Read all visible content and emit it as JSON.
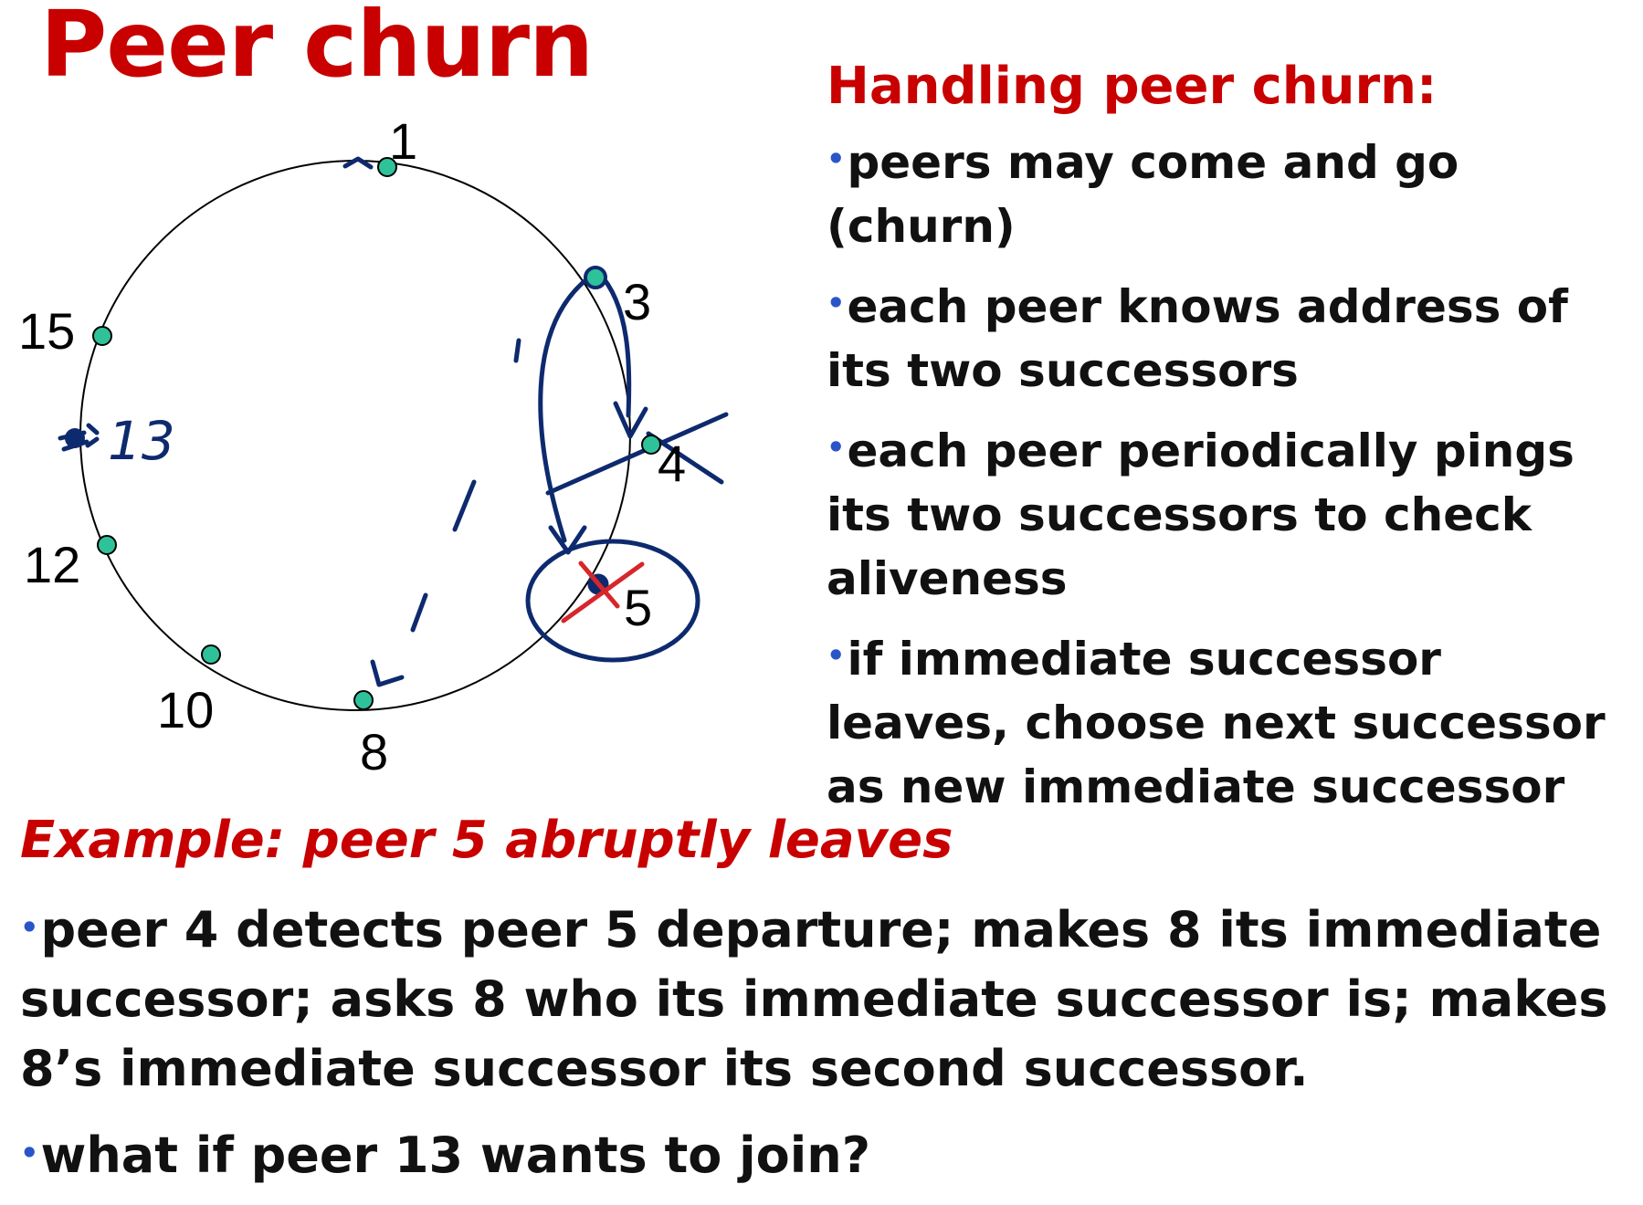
{
  "title": "Peer churn",
  "ring": {
    "nodes": [
      {
        "id": "1",
        "label": "1"
      },
      {
        "id": "3",
        "label": "3"
      },
      {
        "id": "4",
        "label": "4"
      },
      {
        "id": "5",
        "label": "5"
      },
      {
        "id": "8",
        "label": "8"
      },
      {
        "id": "10",
        "label": "10"
      },
      {
        "id": "12",
        "label": "12"
      },
      {
        "id": "15",
        "label": "15"
      }
    ],
    "handwritten_label": "13",
    "colors": {
      "node_fill": "#2fc29a",
      "annotation": "#0e2a6e",
      "cross": "#d7262b"
    }
  },
  "side_panel": {
    "heading": "Handling peer churn:",
    "bullets": [
      "peers may come and go (churn)",
      "each peer knows address of its two successors",
      "each peer periodically pings its two successors to check aliveness",
      "if immediate successor leaves, choose next successor as new immediate successor"
    ]
  },
  "example": {
    "heading": "Example: peer 5 abruptly leaves",
    "bullets": [
      "peer 4 detects peer 5 departure; makes 8 its immediate successor; asks 8 who its immediate successor is; makes 8’s immediate successor its second successor.",
      "what if peer 13 wants to join?"
    ]
  },
  "bullet_glyph": "•",
  "colors": {
    "title": "#c80000",
    "bullet_dot": "#2a55c9",
    "text": "#111111"
  }
}
